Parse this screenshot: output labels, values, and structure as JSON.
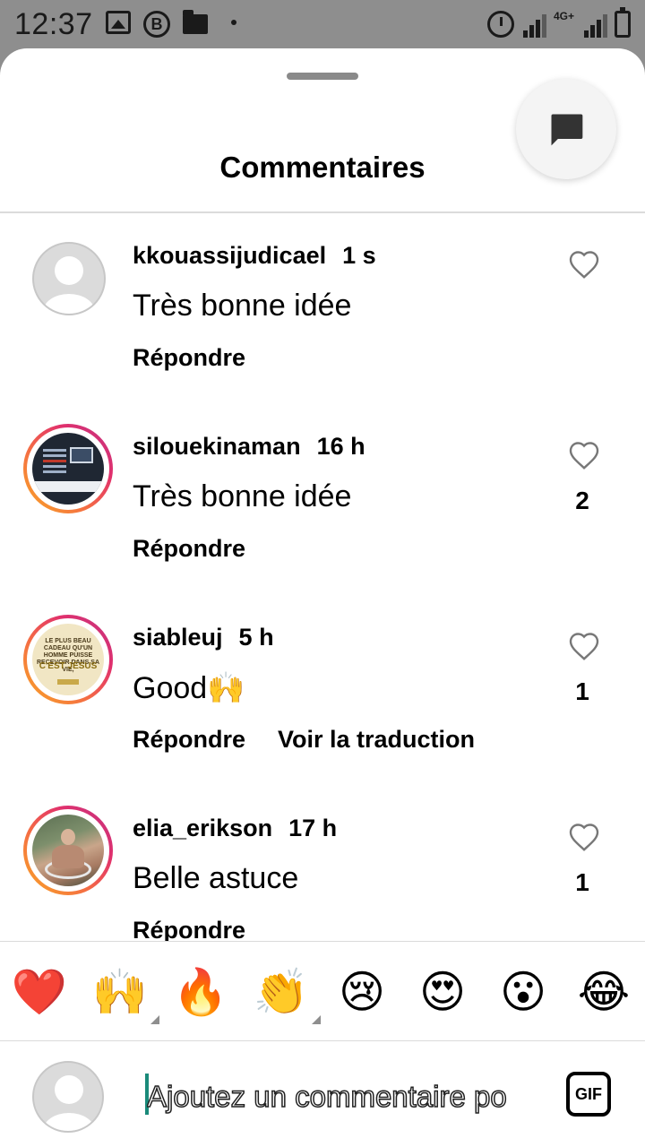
{
  "status_bar": {
    "time": "12:37",
    "network": "4G+",
    "icons": [
      "gallery-icon",
      "b-icon",
      "folder-icon",
      "dot-icon",
      "alarm-icon",
      "signal-icon",
      "signal-icon",
      "battery-icon"
    ]
  },
  "sheet": {
    "title": "Commentaires",
    "share_icon": "chat-bubble-icon"
  },
  "comments": [
    {
      "username": "kkouassijudicael",
      "time": "1 s",
      "text": "Très bonne idée",
      "reply_label": "Répondre",
      "likes": "",
      "avatar": "default"
    },
    {
      "username": "silouekinaman",
      "time": "16 h",
      "text": "Très bonne idée",
      "reply_label": "Répondre",
      "likes": "2",
      "avatar": "story"
    },
    {
      "username": "siableuj",
      "time": "5 h",
      "text": "Good🙌",
      "reply_label": "Répondre",
      "translate_label": "Voir la traduction",
      "likes": "1",
      "avatar": "story"
    },
    {
      "username": "elia_erikson",
      "time": "17 h",
      "text": "Belle astuce",
      "reply_label": "Répondre",
      "likes": "1",
      "avatar": "story"
    }
  ],
  "avatar_texts": {
    "siableuj_line1": "LE PLUS BEAU CADEAU QU'UN HOMME PUISSE RECEVOIR DANS SA VIE,",
    "siableuj_line2": "C'EST JÉSUS"
  },
  "emoji_bar": [
    "❤️",
    "🙌",
    "🔥",
    "👏",
    "😢",
    "😍",
    "😮",
    "😂"
  ],
  "composer": {
    "placeholder": "Ajoutez un commentaire po",
    "gif_label": "GIF"
  }
}
